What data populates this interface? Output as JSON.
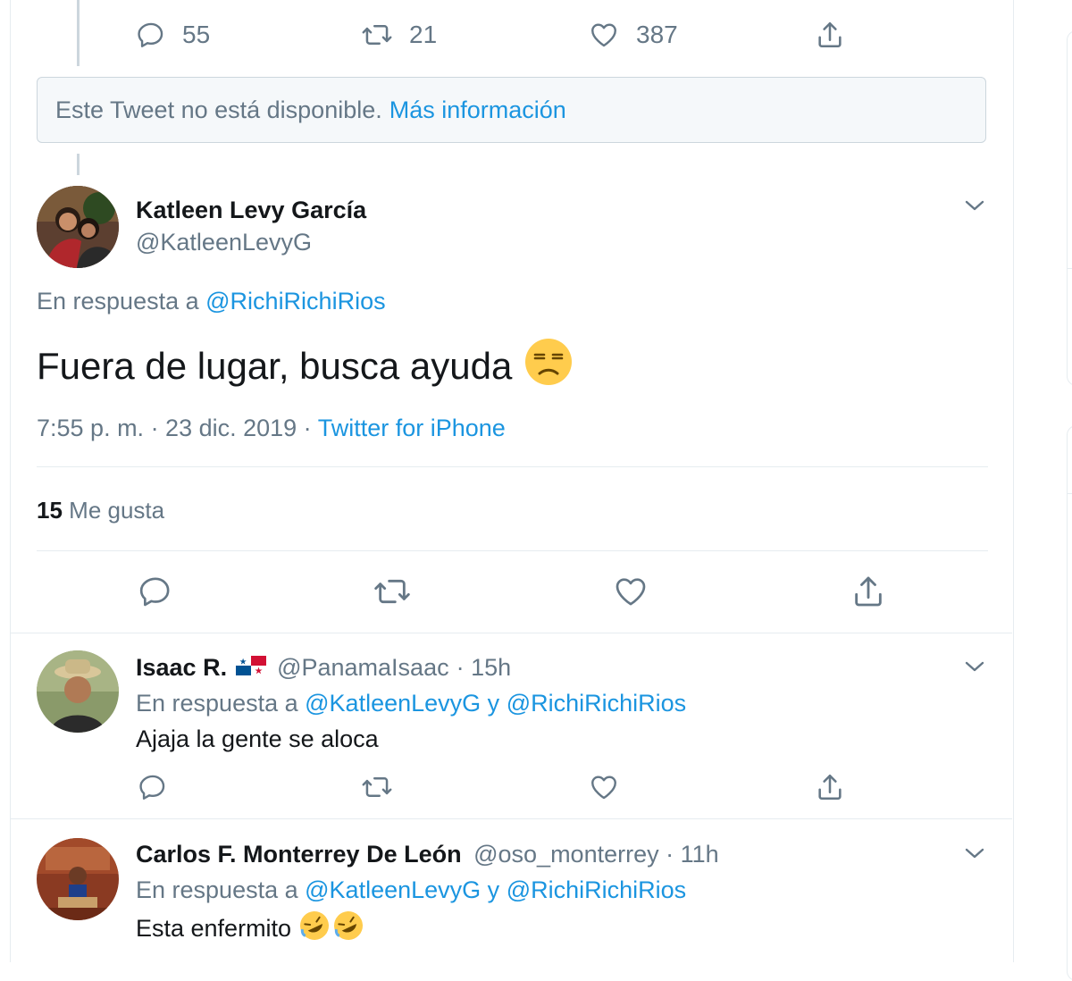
{
  "prev_tweet_actions": {
    "reply_count": "55",
    "retweet_count": "21",
    "like_count": "387"
  },
  "unavailable": {
    "text": "Este Tweet no está disponible.",
    "link": "Más información"
  },
  "main_tweet": {
    "name": "Katleen Levy García",
    "handle": "@KatleenLevyG",
    "reply_prefix": "En respuesta a",
    "reply_to": "@RichiRichiRios",
    "text": "Fuera de lugar, busca ayuda",
    "timestamp": "7:55 p. m. · 23 dic. 2019 ·",
    "source": "Twitter for iPhone",
    "likes_count": "15",
    "likes_label": "Me gusta",
    "emoji": "unamused-face-icon"
  },
  "replies": [
    {
      "name": "Isaac R.",
      "flag": "panama-flag-icon",
      "handle": "@PanamaIsaac",
      "time": "· 15h",
      "reply_prefix": "En respuesta a",
      "reply_to_1": "@KatleenLevyG",
      "conj": "y",
      "reply_to_2": "@RichiRichiRios",
      "text": "Ajaja la gente se aloca"
    },
    {
      "name": "Carlos F. Monterrey De León",
      "handle": "@oso_monterrey",
      "time": "· 11h",
      "reply_prefix": "En respuesta a",
      "reply_to_1": "@KatleenLevyG",
      "conj": "y",
      "reply_to_2": "@RichiRichiRios",
      "text": "Esta enfermito",
      "emoji": "rolling-on-floor-laughing-icon"
    }
  ],
  "colors": {
    "link": "#1b95e0",
    "muted": "#657786",
    "border": "#e6ecf0"
  }
}
